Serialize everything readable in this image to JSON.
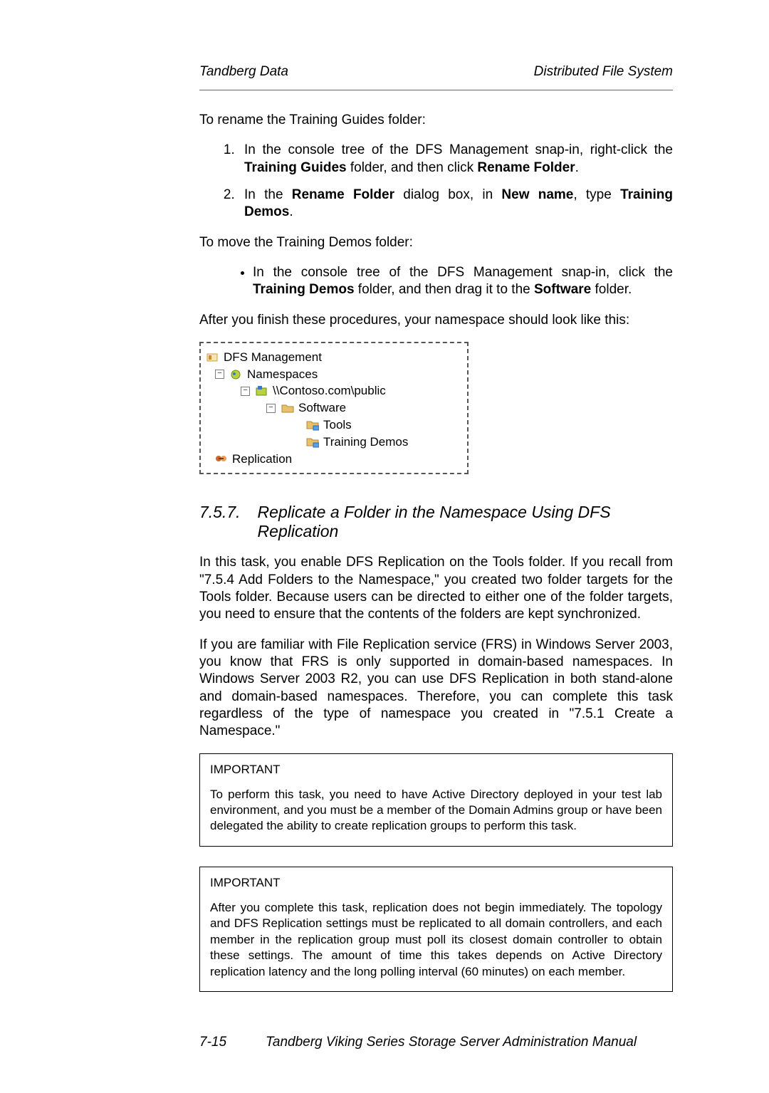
{
  "header": {
    "left": "Tandberg Data",
    "right": "Distributed File System"
  },
  "intro1": "To rename the Training Guides folder:",
  "steps1": [
    "In the console tree of the DFS Management snap-in, right-click the <b>Training Guides</b> folder, and then click <b>Rename Folder</b>.",
    "In the <b>Rename Folder</b> dialog box, in <b>New name</b>, type <b>Training Demos</b>."
  ],
  "intro2": "To move the Training Demos folder:",
  "bullets1": [
    "In the console tree of the DFS Management snap-in, click the <b>Training Demos</b> folder, and then drag it to the <b>Software</b> folder."
  ],
  "after": "After you finish these procedures, your namespace should look like this:",
  "tree": {
    "root": "DFS Management",
    "n1": "Namespaces",
    "n2": "\\\\Contoso.com\\public",
    "n3": "Software",
    "n4a": "Tools",
    "n4b": "Training Demos",
    "rep": "Replication"
  },
  "section": {
    "num": "7.5.7.",
    "title": "Replicate a Folder in the Namespace Using DFS Replication"
  },
  "p1": "In this task, you enable DFS Replication on the Tools folder. If you recall from \"7.5.4 Add Folders to the Namespace,\" you created two folder targets for the Tools folder. Because users can be directed to either one of the folder targets, you need to ensure that the contents of the folders are kept synchronized.",
  "p2": "If you are familiar with File Replication service (FRS) in Windows Server 2003, you know that FRS is only supported in domain-based namespaces. In Windows Server 2003 R2, you can use DFS Replication in both stand-alone and domain-based namespaces. Therefore, you can complete this task regardless of the type of namespace you created in \"7.5.1 Create a Namespace.\"",
  "note1": {
    "label": "IMPORTANT",
    "body": "To perform this task, you need to have Active Directory deployed in your test lab environment, and you must be a member of the Domain Admins group or have been delegated the ability to create replication groups to perform this task."
  },
  "note2": {
    "label": "IMPORTANT",
    "body": "After you complete this task, replication does not begin immediately. The topology and DFS Replication settings must be replicated to all domain controllers, and each member in the replication group must poll its closest domain controller to obtain these settings. The amount of time this takes depends on Active Directory replication latency and the long polling interval (60 minutes) on each member."
  },
  "footer": {
    "page": "7-15",
    "title": "Tandberg Viking Series Storage Server Administration Manual"
  },
  "icons": {
    "mgmt_color": "#d08a2a",
    "ns_color1": "#3a78c8",
    "ns_color2": "#b8d43c",
    "folder_color": "#e8c26a",
    "rep_color": "#cc6a2a"
  }
}
